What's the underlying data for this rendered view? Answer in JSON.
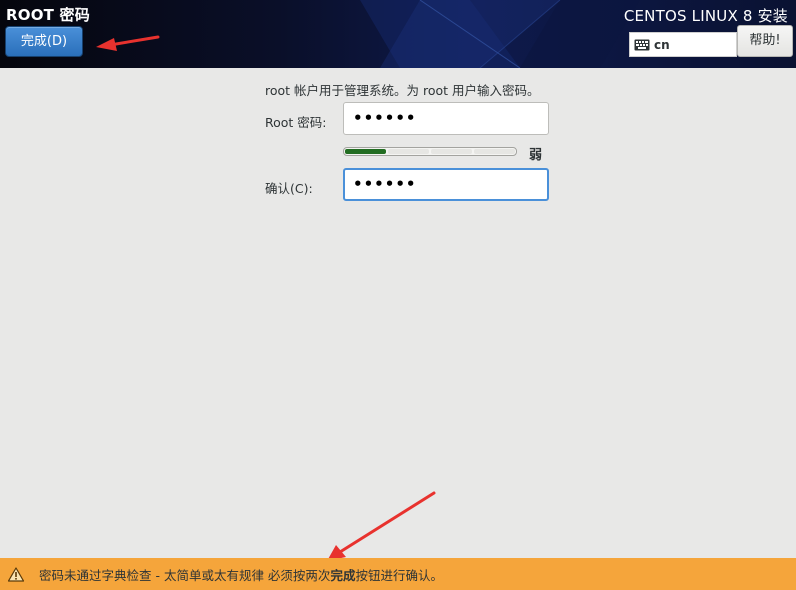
{
  "header": {
    "page_title": "ROOT 密码",
    "done_button_label": "完成(D)",
    "product_title": "CENTOS LINUX 8 安装",
    "keyboard_layout": "cn",
    "help_button_label": "帮助!"
  },
  "form": {
    "info_text": "root 帐户用于管理系统。为 root 用户输入密码。",
    "root_password_label": "Root 密码:",
    "root_password_value": "••••••",
    "confirm_label": "确认(C):",
    "confirm_value": "••••••",
    "strength": {
      "label": "弱",
      "level": 1,
      "segments": 4
    }
  },
  "warning": {
    "text_before": "密码未通过字典检查 - 太简单或太有规律 必须按两次",
    "text_bold": "完成",
    "text_after": "按钮进行确认。"
  },
  "colors": {
    "header_bg": "#0e1a4c",
    "accent_blue": "#4a90d9",
    "strength_fill": "#226d22",
    "warning_bg": "#f5a53b",
    "annotation_red": "#e8322e"
  },
  "icons": {
    "keyboard": "keyboard-icon",
    "warning": "warning-triangle-icon"
  }
}
